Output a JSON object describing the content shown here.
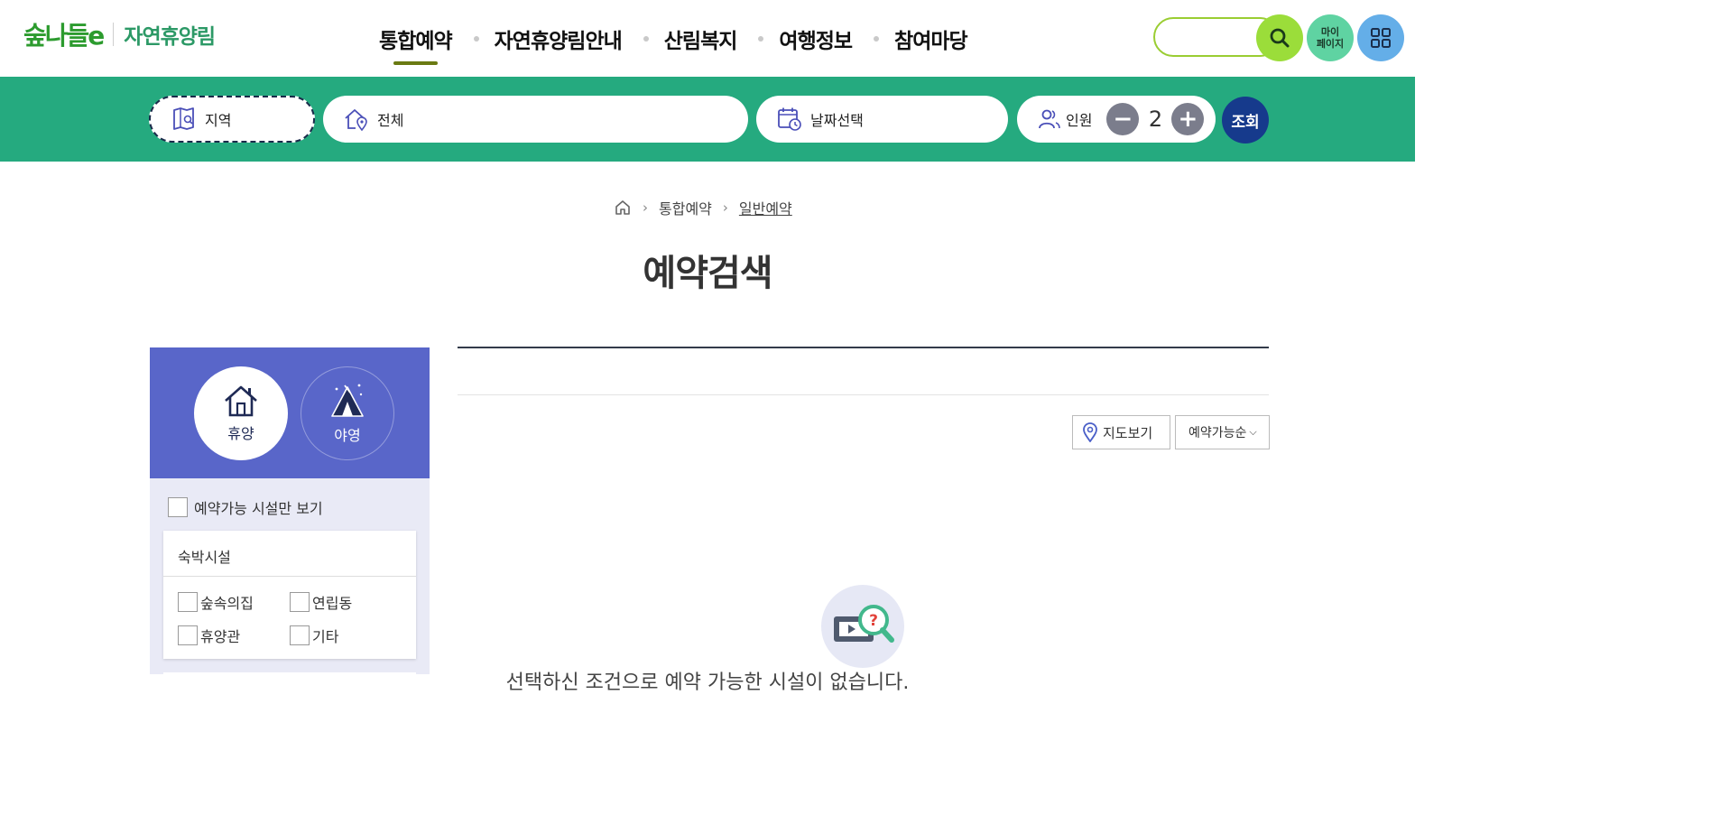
{
  "header": {
    "logo_mark": "숲나들e",
    "logo_text": "자연휴양림",
    "nav": [
      "통합예약",
      "자연휴양림안내",
      "산림복지",
      "여행정보",
      "참여마당"
    ],
    "my_page_line1": "마이",
    "my_page_line2": "페이지"
  },
  "search_bar": {
    "region_label": "지역",
    "area_label": "전체",
    "date_label": "날짜선택",
    "people_label": "인원",
    "people_count": "2",
    "minus_symbol": "−",
    "plus_symbol": "+",
    "query_label": "조회"
  },
  "breadcrumb": {
    "level1": "통합예약",
    "level2": "일반예약"
  },
  "page_title": "예약검색",
  "sidebar": {
    "type_rest": "휴양",
    "type_camp": "야영",
    "available_only": "예약가능 시설만 보기",
    "lodging_title": "숙박시설",
    "lodging_options": [
      "숲속의집",
      "연립동",
      "휴양관",
      "기타"
    ]
  },
  "results": {
    "map_view": "지도보기",
    "sort_value": "예약가능순",
    "empty_message": "선택하신 조건으로 예약 가능한 시설이 없습니다."
  },
  "colors": {
    "green_bar": "#25aa7f",
    "sidebar_panel": "#5966c9",
    "query_button": "#163a8c"
  }
}
